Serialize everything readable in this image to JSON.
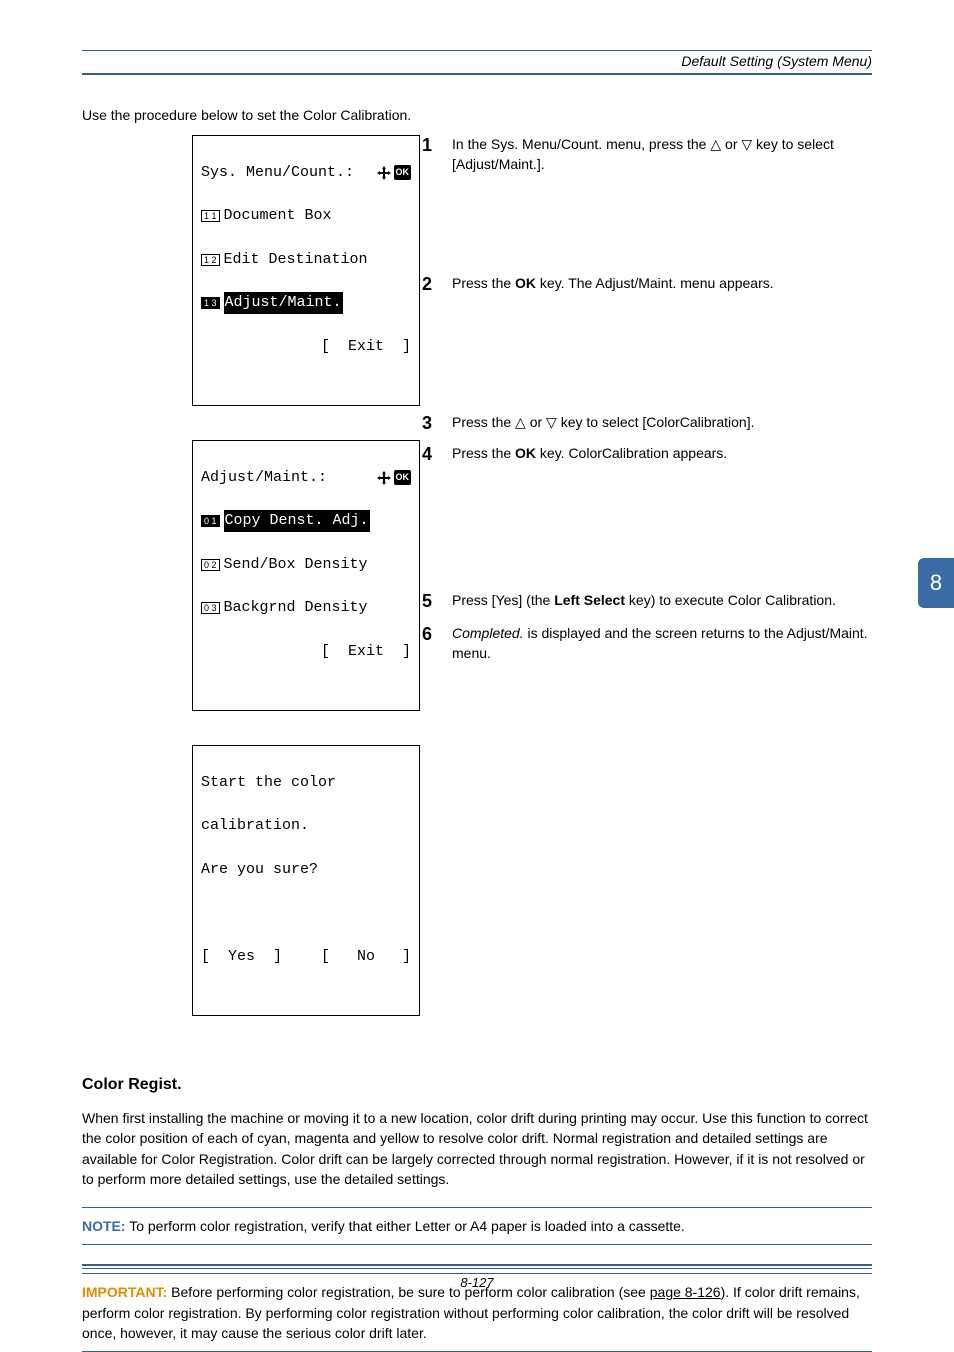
{
  "header": {
    "section_title": "Default Setting (System Menu)"
  },
  "intro": "Use the procedure below to set the Color Calibration.",
  "lcd1": {
    "title_left": "Sys. Menu/Count.",
    "title_sep": ":",
    "items": [
      {
        "num": "1 1",
        "label": "Document Box",
        "hl": false
      },
      {
        "num": "1 2",
        "label": "Edit Destination",
        "hl": false
      },
      {
        "num": "1 3",
        "label": "Adjust/Maint.",
        "hl": true
      }
    ],
    "softkey": "[  Exit  ]"
  },
  "lcd2": {
    "title_left": "Adjust/Maint.",
    "title_sep": ":",
    "items": [
      {
        "num": "0 1",
        "label": "Copy Denst. Adj.",
        "hl": true
      },
      {
        "num": "0 2",
        "label": "Send/Box Density",
        "hl": false
      },
      {
        "num": "0 3",
        "label": "Backgrnd Density",
        "hl": false
      }
    ],
    "softkey": "[  Exit  ]"
  },
  "lcd3": {
    "line1": "Start the color",
    "line2": "calibration.",
    "line3": "Are you sure?",
    "soft_left": "[  Yes  ]",
    "soft_right": "[   No   ]"
  },
  "steps": [
    {
      "n": "1",
      "html": "In the Sys. Menu/Count. menu, press the <span class='tri'>△</span> or <span class='tri'>▽</span> key to select [Adjust/Maint.]."
    },
    {
      "n": "2",
      "html": "Press the <b>OK</b> key. The Adjust/Maint. menu appears."
    },
    {
      "n": "3",
      "html": "Press the <span class='tri'>△</span> or <span class='tri'>▽</span> key to select [ColorCalibration]."
    },
    {
      "n": "4",
      "html": "Press the <b>OK</b> key. ColorCalibration appears."
    },
    {
      "n": "5",
      "html": "Press [Yes] (the <b>Left Select</b> key) to execute Color Calibration."
    },
    {
      "n": "6",
      "html": "<i>Completed.</i> is displayed and the screen returns to the Adjust/Maint. menu."
    }
  ],
  "side_tab": "8",
  "section_heading": "Color Regist.",
  "body_p": "When first installing the machine or moving it to a new location, color drift during printing may occur. Use this function to correct the color position of each of cyan, magenta and yellow to resolve color drift. Normal registration and detailed settings are available for Color Registration. Color drift can be largely corrected through normal registration. However, if it is not resolved or to perform more detailed settings, use the detailed settings.",
  "note": {
    "label": "NOTE:",
    "text": " To perform color registration, verify that either Letter or A4 paper is loaded into a cassette."
  },
  "important": {
    "label": "IMPORTANT:",
    "pre": " Before performing color registration, be sure to perform color calibration (see ",
    "link": "page 8-126",
    "post": "). If color drift remains, perform color registration. By performing color registration without performing color calibration, the color drift will be resolved once, however, it may cause the serious color drift later."
  },
  "footer_page": "8-127"
}
